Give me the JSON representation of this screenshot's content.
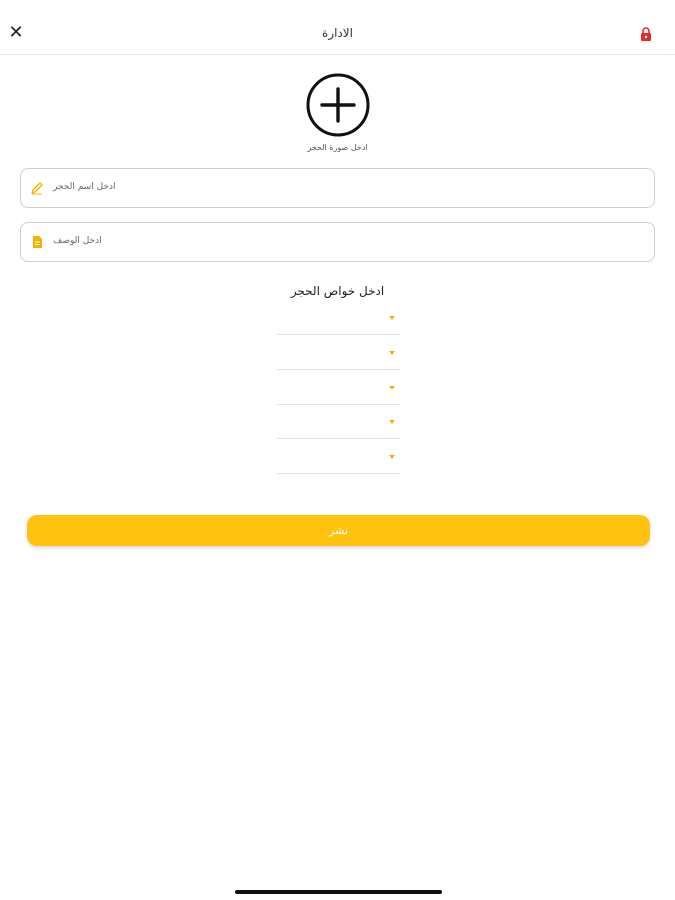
{
  "header": {
    "title": "الادارة",
    "close_label": "✕",
    "lock_icon": "lock-icon",
    "lock_color": "#e22b2b"
  },
  "photo": {
    "icon": "add-circle-icon",
    "label": "ادخل صورة الحجر"
  },
  "fields": {
    "name_placeholder": "ادخل اسم الحجر",
    "name_icon": "pencil-icon",
    "description_placeholder": "ادخل الوصف",
    "description_icon": "document-icon"
  },
  "properties": {
    "title": "ادخل خواص الحجر",
    "dropdowns": [
      "",
      "",
      "",
      "",
      ""
    ]
  },
  "submit": {
    "label": "نشر"
  },
  "colors": {
    "accent": "#ffc20e",
    "icon_accent": "#f3b400",
    "lock": "#e22b2b"
  }
}
